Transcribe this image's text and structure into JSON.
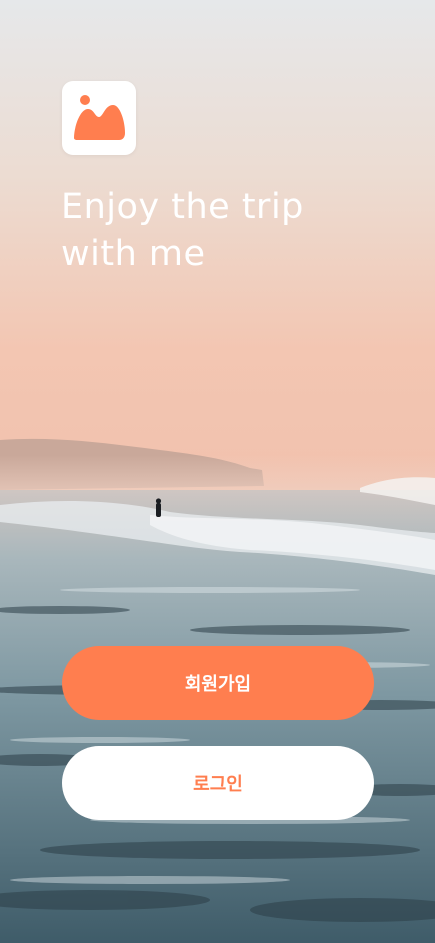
{
  "headline": {
    "line1": "Enjoy the trip",
    "line2": "with me"
  },
  "buttons": {
    "signup_label": "회원가입",
    "login_label": "로그인"
  },
  "colors": {
    "accent": "#FF7E4F",
    "button_light": "#FFFFFF",
    "headline_text": "#FFFFFF"
  },
  "icons": {
    "logo": "image-landscape-icon"
  }
}
